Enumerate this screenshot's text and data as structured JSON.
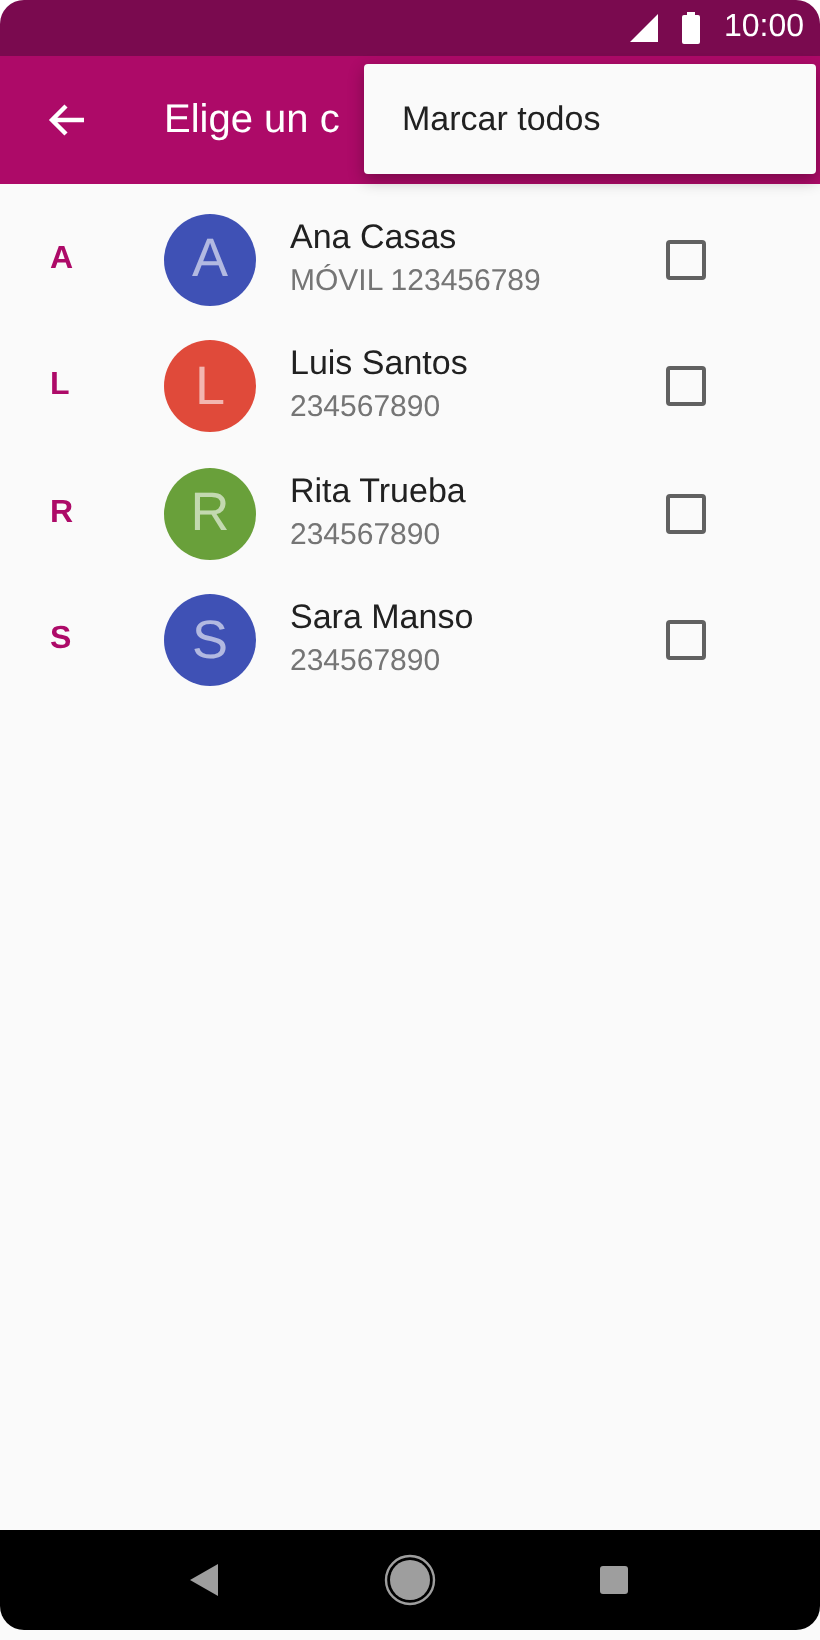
{
  "status_bar": {
    "time": "10:00"
  },
  "app_bar": {
    "title": "Elige un c"
  },
  "menu": {
    "items": [
      "Marcar todos"
    ]
  },
  "contacts": [
    {
      "section": "A",
      "initial": "A",
      "color": "#3f51b5",
      "name": "Ana Casas",
      "number": "MÓVIL 123456789",
      "checked": false
    },
    {
      "section": "L",
      "initial": "L",
      "color": "#e04a3a",
      "name": "Luis Santos",
      "number": "234567890",
      "checked": false
    },
    {
      "section": "R",
      "initial": "R",
      "color": "#69a03a",
      "name": "Rita Trueba",
      "number": "234567890",
      "checked": false
    },
    {
      "section": "S",
      "initial": "S",
      "color": "#3f51b5",
      "name": "Sara Manso",
      "number": "234567890",
      "checked": false
    }
  ]
}
